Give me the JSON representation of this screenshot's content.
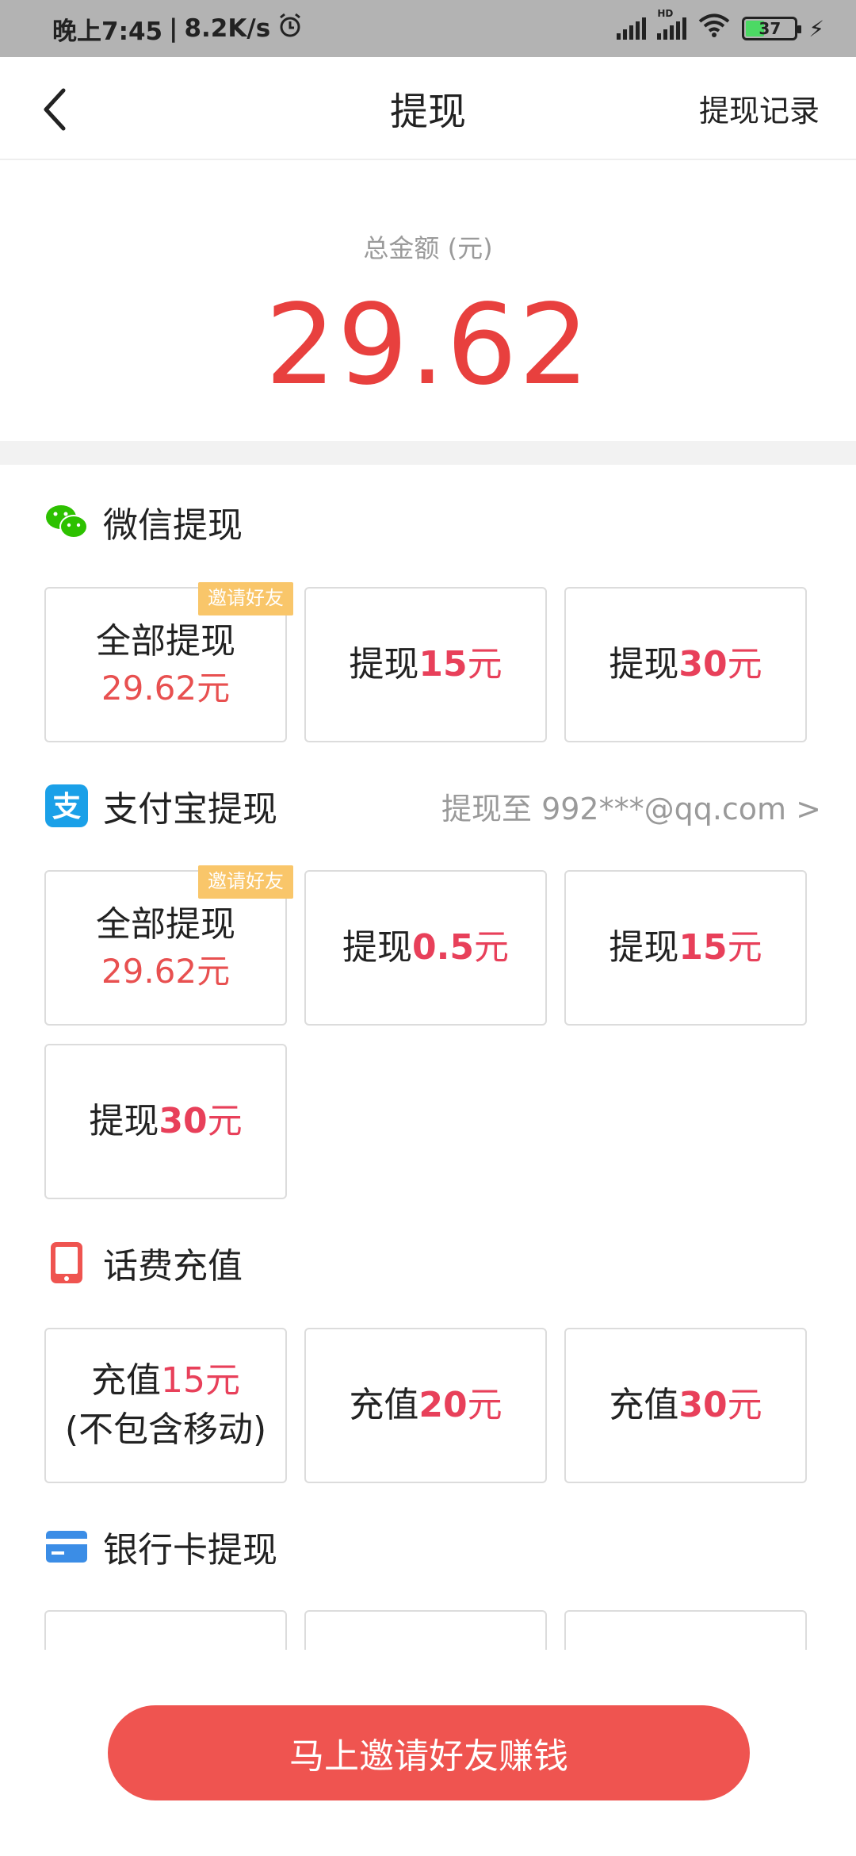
{
  "status": {
    "time": "晚上7:45",
    "speed": "8.2K/s",
    "hd": "HD",
    "battery": "37"
  },
  "nav": {
    "title": "提现",
    "record": "提现记录"
  },
  "total": {
    "label": "总金额 (元)",
    "amount": "29.62"
  },
  "sections": {
    "wechat": {
      "name": "微信提现",
      "options": [
        {
          "line1": "全部提现",
          "line2": "29.62元",
          "badge": "邀请好友"
        },
        {
          "prefix": "提现",
          "amount": "15",
          "unit": "元"
        },
        {
          "prefix": "提现",
          "amount": "30",
          "unit": "元"
        }
      ]
    },
    "alipay": {
      "name": "支付宝提现",
      "target": "提现至 992***@qq.com >",
      "options": [
        {
          "line1": "全部提现",
          "line2": "29.62元",
          "badge": "邀请好友"
        },
        {
          "prefix": "提现",
          "amount": "0.5",
          "unit": "元"
        },
        {
          "prefix": "提现",
          "amount": "15",
          "unit": "元"
        },
        {
          "prefix": "提现",
          "amount": "30",
          "unit": "元"
        }
      ]
    },
    "phone": {
      "name": "话费充值",
      "options": [
        {
          "prefix": "充值",
          "amount": "15",
          "unit": "元",
          "note": "(不包含移动)"
        },
        {
          "prefix": "充值",
          "amount": "20",
          "unit": "元"
        },
        {
          "prefix": "充值",
          "amount": "30",
          "unit": "元"
        }
      ]
    },
    "bank": {
      "name": "银行卡提现"
    }
  },
  "bottom_button": "马上邀请好友赚钱",
  "colors": {
    "accent_red": "#e8403e",
    "button_red": "#ef5450",
    "badge_yellow": "#f9c66a",
    "wechat_green": "#2dc100",
    "alipay_blue": "#1aa0e8",
    "phone_red": "#ef5450",
    "bank_blue": "#3b8de6"
  }
}
